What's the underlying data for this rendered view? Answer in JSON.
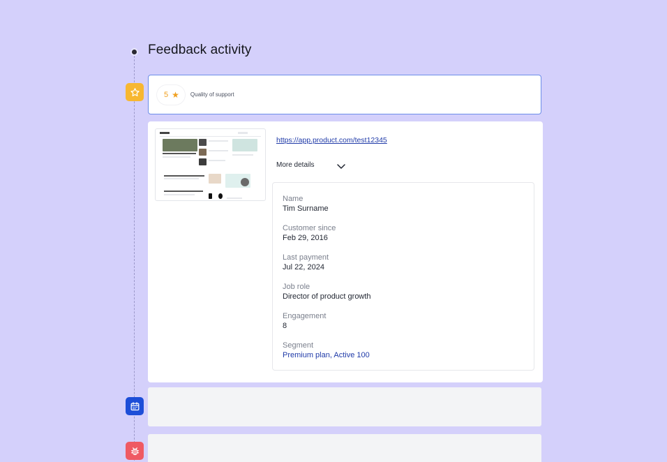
{
  "page": {
    "title": "Feedback activity"
  },
  "rating": {
    "value": "5",
    "label": "Quality of support"
  },
  "detail": {
    "link": "https://app.product.com/test12345",
    "more_details": "More details",
    "fields": [
      {
        "label": "Name",
        "value": "Tim Surname"
      },
      {
        "label": "Customer since",
        "value": "Feb 29, 2016"
      },
      {
        "label": "Last payment",
        "value": "Jul 22, 2024"
      },
      {
        "label": "Job role",
        "value": "Director of product growth"
      },
      {
        "label": "Engagement",
        "value": "8"
      },
      {
        "label": "Segment",
        "value": "Premium plan, Active 100"
      }
    ]
  },
  "icons": {
    "timeline_markers": [
      "star-icon",
      "calendar-icon",
      "bug-icon"
    ],
    "rating": "star-icon",
    "toggle": "chevron-down-icon"
  },
  "colors": {
    "background": "#d4d0fb",
    "marker_star": "#f7b731",
    "marker_calendar": "#1d4ed8",
    "marker_bug": "#ef5a63",
    "link": "#1f3aa8",
    "rating": "#f0a020"
  }
}
